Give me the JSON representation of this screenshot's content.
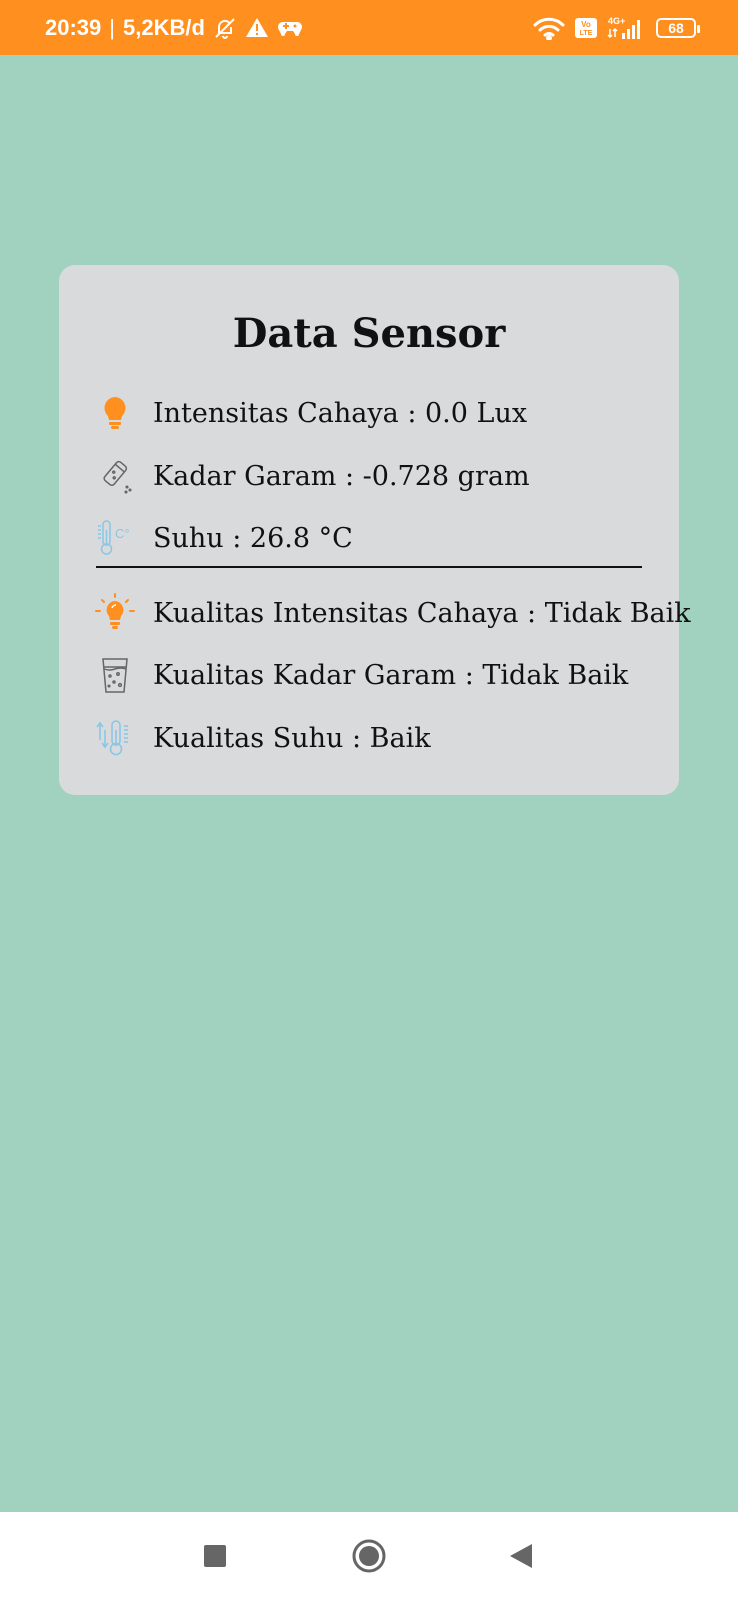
{
  "status_bar": {
    "time": "20:39",
    "separator": "|",
    "net_speed": "5,2KB/d",
    "battery": "68",
    "background": "#ff8f1f"
  },
  "card": {
    "title": "Data Sensor",
    "sensor_rows": [
      {
        "icon": "lightbulb-icon",
        "text": "Intensitas Cahaya : 0.0 Lux",
        "color": "#ff8f1f"
      },
      {
        "icon": "salt-shaker-icon",
        "text": "Kadar Garam : -0.728 gram",
        "color": "#555555"
      },
      {
        "icon": "thermometer-celsius-icon",
        "text": "Suhu : 26.8 °C",
        "color": "#8ac6e6"
      }
    ],
    "quality_rows": [
      {
        "icon": "glowing-lightbulb-icon",
        "text": "Kualitas Intensitas Cahaya : Tidak Baik",
        "color": "#ff8f1f"
      },
      {
        "icon": "water-glass-icon",
        "text": "Kualitas Kadar Garam : Tidak Baik",
        "color": "#555555"
      },
      {
        "icon": "thermometer-arrows-icon",
        "text": "Kualitas Suhu : Baik",
        "color": "#8ac6e6"
      }
    ]
  },
  "colors": {
    "background": "#a0d2bf",
    "card": "#d9dadc",
    "accent": "#ff8f1f"
  },
  "nav_bar": {
    "recents": "recents-button",
    "home": "home-button",
    "back": "back-button"
  }
}
